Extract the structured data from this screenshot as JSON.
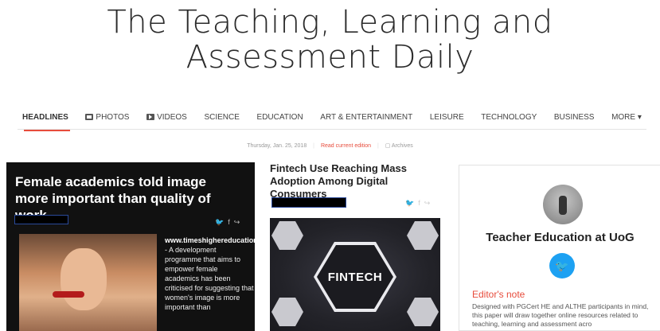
{
  "masthead": {
    "line1": "The Teaching, Learning and",
    "line2": "Assessment Daily"
  },
  "nav": {
    "items": [
      {
        "label": "HEADLINES",
        "icon": ""
      },
      {
        "label": "PHOTOS",
        "icon": "photo-icon"
      },
      {
        "label": "VIDEOS",
        "icon": "video-icon"
      },
      {
        "label": "SCIENCE",
        "icon": ""
      },
      {
        "label": "EDUCATION",
        "icon": ""
      },
      {
        "label": "ART & ENTERTAINMENT",
        "icon": ""
      },
      {
        "label": "LEISURE",
        "icon": ""
      },
      {
        "label": "TECHNOLOGY",
        "icon": ""
      },
      {
        "label": "BUSINESS",
        "icon": ""
      },
      {
        "label": "MORE ▾",
        "icon": ""
      }
    ],
    "active_color": "#e74c3c"
  },
  "dateline": {
    "date": "Thursday, Jan. 25, 2018",
    "current": "Read current edition",
    "archives": "Archives"
  },
  "articles": [
    {
      "title": "Female academics told image more important than quality of work",
      "source": "www.timeshighereducation.com",
      "excerpt": " - A development programme that aims to empower female academics has been criticised for suggesting that women's image is more important than"
    },
    {
      "title": "Fintech Use Reaching Mass Adoption Among Digital Consumers",
      "image_text": "FINTECH"
    }
  ],
  "sidebar": {
    "name": "Teacher Education at UoG",
    "editor_title": "Editor's note",
    "editor_body": "Designed with PGCert HE and ALTHE participants in mind, this paper will draw together online resources related to teaching, learning and assessment acro"
  }
}
